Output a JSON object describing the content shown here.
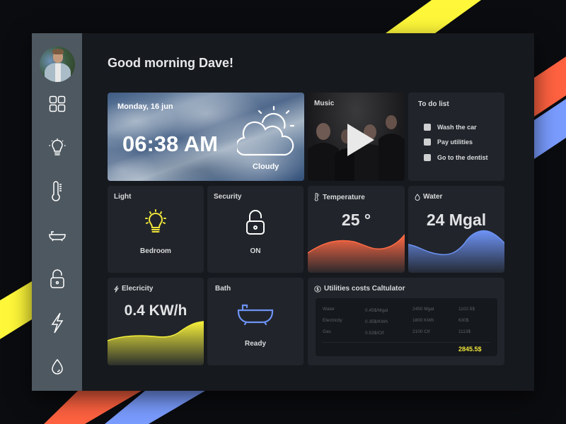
{
  "greeting": "Good morning Dave!",
  "sidebar": {
    "items": [
      {
        "id": "dashboard",
        "icon": "grid-icon"
      },
      {
        "id": "light",
        "icon": "lightbulb-icon"
      },
      {
        "id": "temperature",
        "icon": "thermometer-icon"
      },
      {
        "id": "bath",
        "icon": "bathtub-icon"
      },
      {
        "id": "security",
        "icon": "lock-icon"
      },
      {
        "id": "electricity",
        "icon": "lightning-icon"
      },
      {
        "id": "water",
        "icon": "water-drop-icon"
      }
    ]
  },
  "weather": {
    "date": "Monday, 16 jun",
    "time": "06:38 AM",
    "condition": "Cloudy",
    "icon": "partly-cloudy-icon"
  },
  "music": {
    "title": "Music",
    "icon": "play-icon"
  },
  "todo": {
    "title": "To do list",
    "items": [
      {
        "label": "Wash the car",
        "checked": false
      },
      {
        "label": "Pay utilities",
        "checked": false
      },
      {
        "label": "Go to the dentist",
        "checked": false
      }
    ]
  },
  "light": {
    "title": "Light",
    "room": "Bedroom",
    "color": "#f0e53b"
  },
  "security": {
    "title": "Security",
    "status": "ON"
  },
  "temperature": {
    "title": "Temperature",
    "value": "25 °",
    "color": "#ff6a45"
  },
  "water": {
    "title": "Water",
    "value": "24 Mgal",
    "color": "#6d93f5"
  },
  "electricity": {
    "title": "Elecricity",
    "value": "0.4 KW/h",
    "color": "#f5ef3a"
  },
  "bath": {
    "title": "Bath",
    "status": "Ready",
    "color": "#6d93f5"
  },
  "utilities": {
    "title": "Utilities costs Caltulator",
    "rows": [
      {
        "name": "Water",
        "rate": "0.45$/Mgal",
        "usage": "2450 Mgal",
        "cost": "1102.5$"
      },
      {
        "name": "Electricity",
        "rate": "0.35$/KWh",
        "usage": "1800 KWh",
        "cost": "630$"
      },
      {
        "name": "Gas",
        "rate": "0.53$/Ctf",
        "usage": "2100 Ctf",
        "cost": "1113$"
      }
    ],
    "total": "2845.5$",
    "total_color": "#f0e53b"
  },
  "decor": {
    "stripe_colors": [
      "#fff83a",
      "#ff6240",
      "#7a9cff"
    ]
  }
}
